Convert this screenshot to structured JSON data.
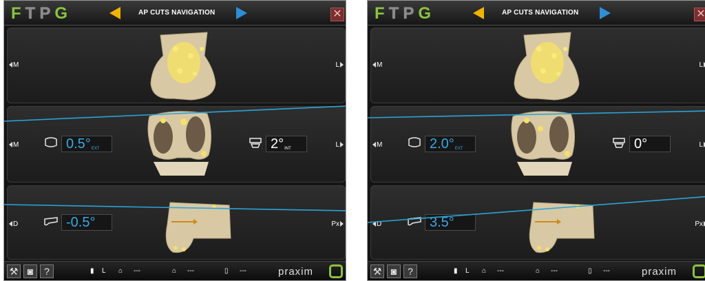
{
  "screens": [
    {
      "header": {
        "logo_f": "F",
        "logo_t": "T",
        "logo_p": "P",
        "logo_g": "G",
        "title": "AP CUTS NAVIGATION",
        "close_label": "✕"
      },
      "panel_top": {
        "left_label": "M",
        "right_label": "L"
      },
      "panel_mid": {
        "left_label": "M",
        "right_label": "L",
        "rotation_value": "0.5°",
        "rotation_sub": "EXT",
        "tibia_value": "2°",
        "tibia_sub": "INT"
      },
      "panel_bot": {
        "left_label": "D",
        "right_label": "Px",
        "flexion_value": "-0.5°"
      },
      "bottom": {
        "help_label": "?",
        "leg_side": "L",
        "impl1": "---",
        "impl2": "---",
        "impl3": "---",
        "brand": "praxim"
      }
    },
    {
      "header": {
        "logo_f": "F",
        "logo_t": "T",
        "logo_p": "P",
        "logo_g": "G",
        "title": "AP CUTS NAVIGATION",
        "close_label": "✕"
      },
      "panel_top": {
        "left_label": "M",
        "right_label": "L"
      },
      "panel_mid": {
        "left_label": "M",
        "right_label": "L",
        "rotation_value": "2.0°",
        "rotation_sub": "EXT",
        "tibia_value": "0°",
        "tibia_sub": ""
      },
      "panel_bot": {
        "left_label": "D",
        "right_label": "Px",
        "flexion_value": "3.5°"
      },
      "bottom": {
        "help_label": "?",
        "leg_side": "L",
        "impl1": "---",
        "impl2": "---",
        "impl3": "---",
        "brand": "praxim"
      }
    }
  ],
  "colors": {
    "accent_blue": "#38a9e4",
    "nav_yellow": "#f0b400",
    "nav_blue": "#2e8ed6",
    "brand_green": "#8ac43f",
    "bone": "#d8c8a4",
    "marker_yellow": "#f4e06a"
  }
}
